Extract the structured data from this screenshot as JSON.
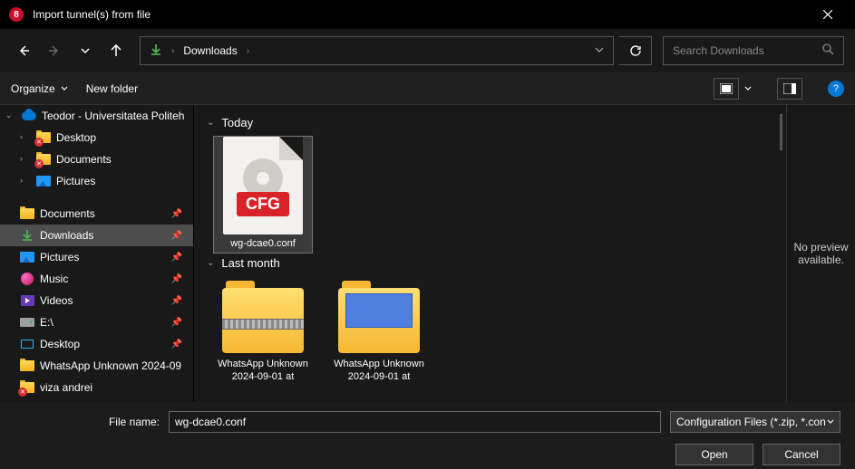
{
  "titlebar": {
    "title": "Import tunnel(s) from file"
  },
  "navbar": {
    "breadcrumb_current": "Downloads",
    "search_placeholder": "Search Downloads"
  },
  "toolbar": {
    "organize_label": "Organize",
    "newfolder_label": "New folder"
  },
  "sidebar": {
    "cloud_root": "Teodor - Universitatea Politeh",
    "cloud_children": [
      "Desktop",
      "Documents",
      "Pictures"
    ],
    "quick": [
      {
        "label": "Documents",
        "kind": "folder",
        "pin": true
      },
      {
        "label": "Downloads",
        "kind": "download",
        "pin": true,
        "selected": true
      },
      {
        "label": "Pictures",
        "kind": "pictures",
        "pin": true
      },
      {
        "label": "Music",
        "kind": "music",
        "pin": true
      },
      {
        "label": "Videos",
        "kind": "video",
        "pin": true
      },
      {
        "label": "E:\\",
        "kind": "drive",
        "pin": true
      },
      {
        "label": "Desktop",
        "kind": "monitor",
        "pin": true
      },
      {
        "label": "WhatsApp Unknown 2024-09",
        "kind": "folder",
        "pin": false
      },
      {
        "label": "viza andrei",
        "kind": "folder",
        "pin": false,
        "badge": true
      }
    ]
  },
  "content": {
    "groups": [
      {
        "header": "Today",
        "items": [
          {
            "type": "cfg",
            "label": "wg-dcae0.conf",
            "selected": true
          }
        ]
      },
      {
        "header": "Last month",
        "items": [
          {
            "type": "zip",
            "label": "WhatsApp Unknown 2024-09-01 at"
          },
          {
            "type": "docfolder",
            "label": "WhatsApp Unknown 2024-09-01 at"
          }
        ]
      }
    ],
    "preview_text": "No preview available."
  },
  "footer": {
    "filename_label": "File name:",
    "filename_value": "wg-dcae0.conf",
    "filetype_label": "Configuration Files (*.zip, *.con",
    "open_label": "Open",
    "cancel_label": "Cancel"
  }
}
